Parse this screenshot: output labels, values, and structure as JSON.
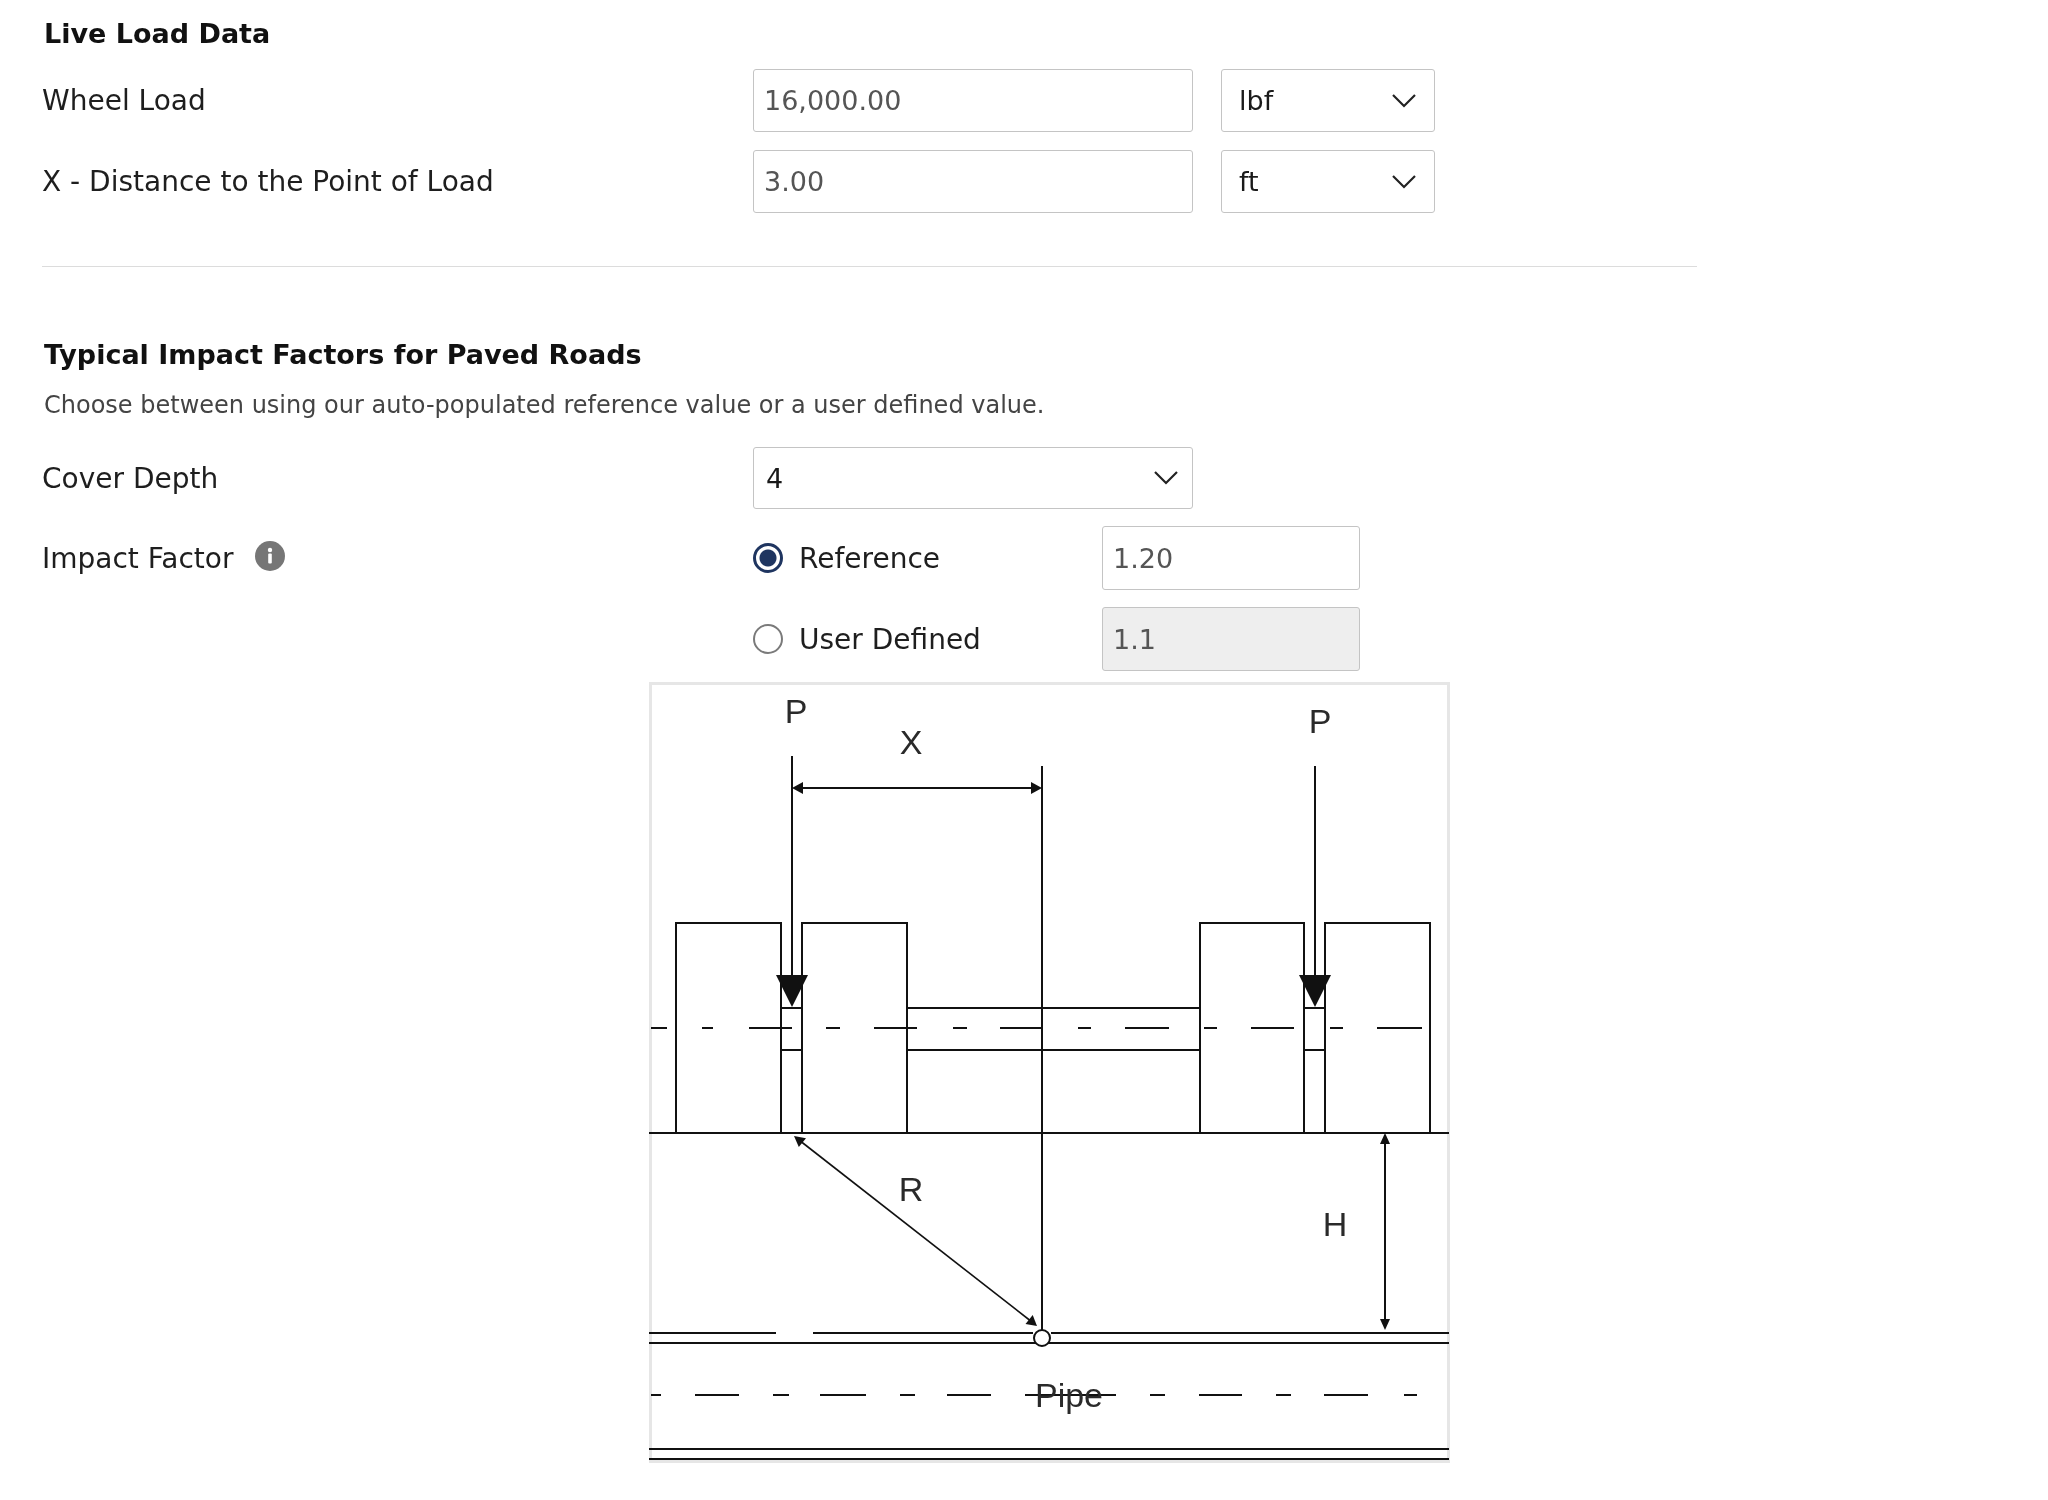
{
  "live_load": {
    "title": "Live Load Data",
    "rows": [
      {
        "label": "Wheel Load",
        "value": "16,000.00",
        "unit": "lbf"
      },
      {
        "label": "X - Distance to the Point of Load",
        "value": "3.00",
        "unit": "ft"
      }
    ]
  },
  "impact_factors": {
    "title": "Typical Impact Factors for Paved Roads",
    "description": "Choose between using our auto-populated reference value or a user defined value.",
    "cover_depth": {
      "label": "Cover Depth",
      "value": "4"
    },
    "impact_factor": {
      "label": "Impact Factor",
      "options": [
        {
          "label": "Reference",
          "selected": true,
          "value": "1.20",
          "disabled": false
        },
        {
          "label": "User Defined",
          "selected": false,
          "value": "1.1",
          "disabled": true
        }
      ]
    }
  },
  "diagram": {
    "load_labels": [
      "P",
      "P"
    ],
    "offset_label": "X",
    "radius_label": "R",
    "depth_label": "H",
    "pipe_label": "Pipe"
  }
}
